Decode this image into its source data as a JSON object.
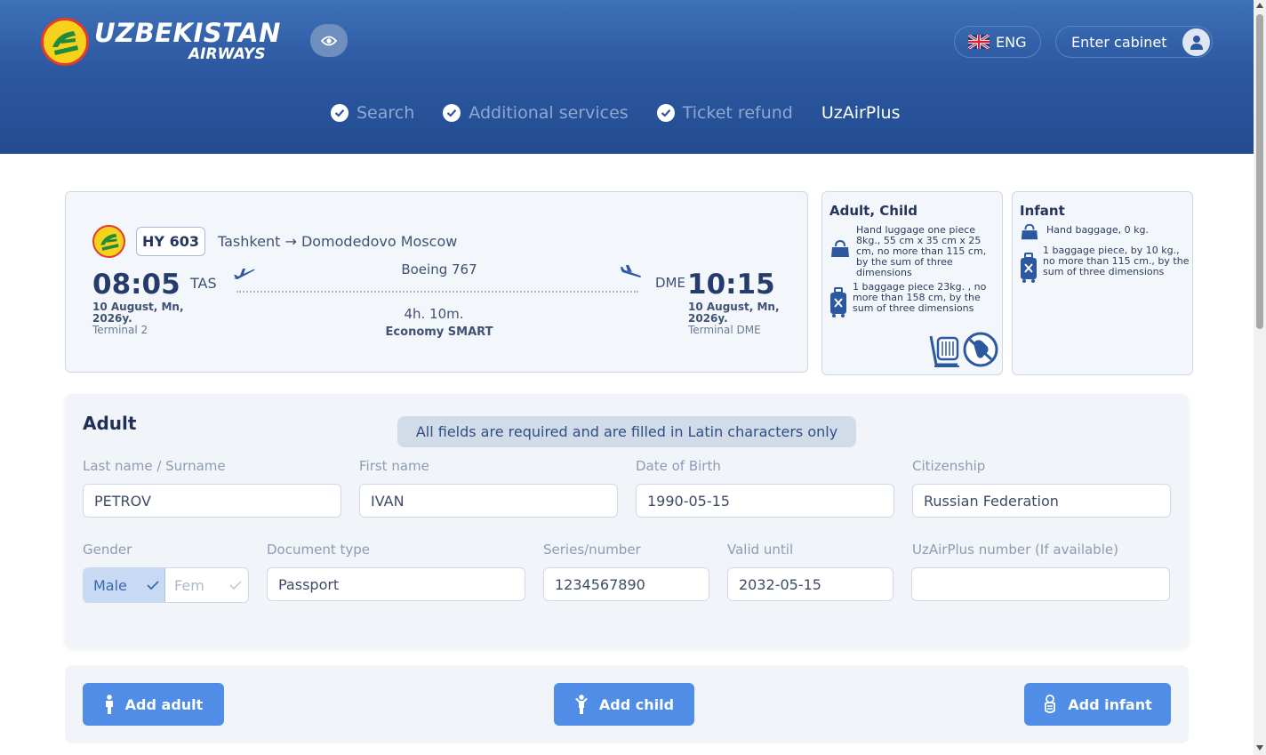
{
  "header": {
    "brand_name": "UZBEKISTAN",
    "brand_sub": "AIRWAYS",
    "language": "ENG",
    "cabinet_label": "Enter cabinet",
    "nav": [
      {
        "label": "Search",
        "checked": true
      },
      {
        "label": "Additional services",
        "checked": true
      },
      {
        "label": "Ticket refund",
        "checked": true
      },
      {
        "label": "UzAirPlus",
        "checked": false,
        "active": true
      }
    ]
  },
  "flight": {
    "number": "HY 603",
    "route": "Tashkent → Domodedovo Moscow",
    "departure": {
      "time": "08:05",
      "code": "TAS",
      "date": "10 August, Mn, 2026y.",
      "terminal": "Terminal 2"
    },
    "arrival": {
      "time": "10:15",
      "code": "DME",
      "date": "10 August, Mn, 2026y.",
      "terminal": "Terminal DME"
    },
    "aircraft": "Boeing 767",
    "duration": "4h. 10m.",
    "cabin": "Economy SMART"
  },
  "baggage": {
    "adult_child": {
      "title": "Adult, Child",
      "hand": "Hand luggage one piece 8kg., 55 cm x 35 cm x 25 cm, no more than 115 cm, by the sum of three dimensions",
      "checked": "1 baggage piece 23kg. , no more than 158 cm, by the sum of three dimensions"
    },
    "infant": {
      "title": "Infant",
      "hand": "Hand baggage, 0 kg.",
      "checked": "1 baggage piece, by 10 kg., no more than 115 cm., by the sum of three dimensions"
    }
  },
  "passenger": {
    "title": "Adult",
    "notice": "All fields are required and are filled in Latin characters only",
    "labels": {
      "last_name": "Last name / Surname",
      "first_name": "First name",
      "dob": "Date of Birth",
      "citizenship": "Citizenship",
      "gender": "Gender",
      "doc_type": "Document type",
      "series": "Series/number",
      "valid_until": "Valid until",
      "uzairplus": "UzAirPlus number (If available)"
    },
    "values": {
      "last_name": "PETROV",
      "first_name": "IVAN",
      "dob": "1990-05-15",
      "citizenship": "Russian Federation",
      "gender_male": "Male",
      "gender_female": "Fem",
      "doc_type": "Passport",
      "series": "1234567890",
      "valid_until": "2032-05-15",
      "uzairplus": ""
    }
  },
  "actions": {
    "add_adult": "Add adult",
    "add_child": "Add child",
    "add_infant": "Add infant"
  },
  "colors": {
    "header_blue": "#2c58a0",
    "accent_button": "#4f8de6",
    "brand_yellow": "#f7d21c",
    "brand_red": "#e53a2d"
  }
}
